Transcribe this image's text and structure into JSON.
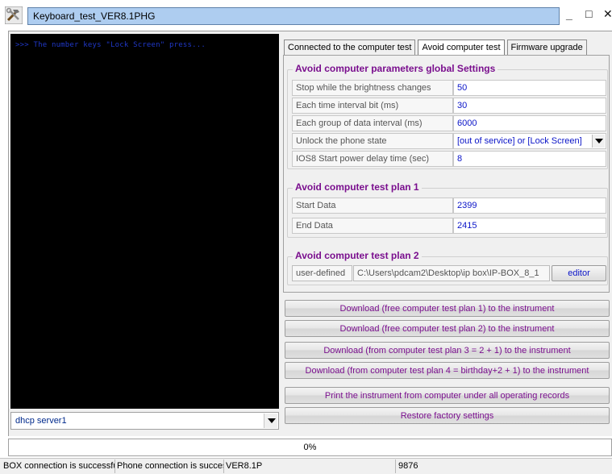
{
  "window": {
    "title": "Keyboard_test_VER8.1PHG",
    "minimize_glyph": "_",
    "maximize_glyph": "□",
    "close_glyph": "✕",
    "icon": "hammer-tools-icon"
  },
  "console": {
    "text": ">>> The number keys \"Lock Screen\" press...",
    "text_color": "#2038c8",
    "background": "#000000"
  },
  "port_select": {
    "value": "dhcp server1"
  },
  "tabs": [
    {
      "label": "Connected to the computer test",
      "active": false
    },
    {
      "label": "Avoid computer test",
      "active": true
    },
    {
      "label": "Firmware upgrade",
      "active": false
    }
  ],
  "global_settings": {
    "title": "Avoid computer parameters global Settings",
    "rows": [
      {
        "label": "Stop while the brightness changes",
        "value": "50"
      },
      {
        "label": "Each time interval bit (ms)",
        "value": "30"
      },
      {
        "label": "Each group of data interval (ms)",
        "value": "6000"
      },
      {
        "label": "Unlock the phone state",
        "value": "[out of service] or [Lock Screen]"
      },
      {
        "label": "IOS8 Start power delay time (sec)",
        "value": "8"
      }
    ]
  },
  "plan1": {
    "title": "Avoid computer test plan 1",
    "rows": [
      {
        "label": "Start Data",
        "value": "2399"
      },
      {
        "label": "End Data",
        "value": "2415"
      }
    ]
  },
  "plan2": {
    "title": "Avoid computer test plan 2",
    "label": "user-defined",
    "path": "C:\\Users\\pdcam2\\Desktop\\ip box\\IP-BOX_8_1",
    "editor_label": "editor"
  },
  "actions": [
    "Download (free computer test plan 1) to the instrument",
    "Download (free computer test plan 2) to the instrument",
    "Download (from computer test plan 3 = 2 + 1) to the instrument",
    "Download (from computer test plan 4 = birthday+2 + 1) to the instrument",
    "Print the instrument from computer under all operating records",
    "Restore factory settings"
  ],
  "progress": {
    "text": "0%",
    "fraction": 0
  },
  "status": {
    "box": "BOX connection is successful",
    "phone": "Phone connection is successful",
    "version": "VER8.1P",
    "code": "9876"
  },
  "colors": {
    "accent_purple": "#7a0f8e",
    "value_blue": "#0a14c8",
    "title_field": "#aecdf0"
  }
}
